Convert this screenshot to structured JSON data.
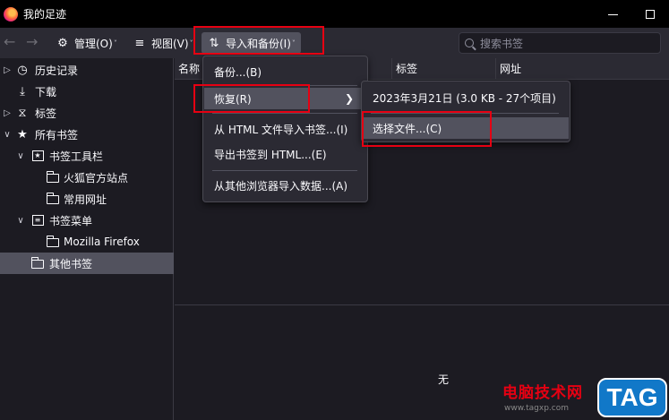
{
  "window": {
    "title": "我的足迹"
  },
  "toolbar": {
    "organize_label": "管理(O)",
    "views_label": "视图(V)",
    "import_backup_label": "导入和备份(I)",
    "search_placeholder": "搜索书签"
  },
  "sidebar": {
    "history": "历史记录",
    "downloads": "下载",
    "tags": "标签",
    "all_bookmarks": "所有书签",
    "toolbar_folder": "书签工具栏",
    "toolbar_child_1": "火狐官方站点",
    "toolbar_child_2": "常用网址",
    "menu_folder": "书签菜单",
    "menu_child_1": "Mozilla Firefox",
    "other_bookmarks": "其他书签"
  },
  "columns": {
    "name": "名称",
    "tags": "标签",
    "url": "网址"
  },
  "details": {
    "empty_text": "无"
  },
  "import_menu": {
    "backup": "备份...(B)",
    "restore": "恢复(R)",
    "import_html": "从 HTML 文件导入书签...(I)",
    "export_html": "导出书签到 HTML...(E)",
    "import_other": "从其他浏览器导入数据...(A)"
  },
  "restore_menu": {
    "backup_entry": "2023年3月21日 (3.0 KB - 27个项目)",
    "choose_file": "选择文件...(C)"
  },
  "watermark": {
    "text": "电脑技术网",
    "url": "www.tagxp.com",
    "badge": "TAG"
  },
  "colors": {
    "highlight_box": "#e60012",
    "menu_bg": "#2b2a33",
    "hover_bg": "#52525e",
    "window_bg": "#1c1b22"
  }
}
